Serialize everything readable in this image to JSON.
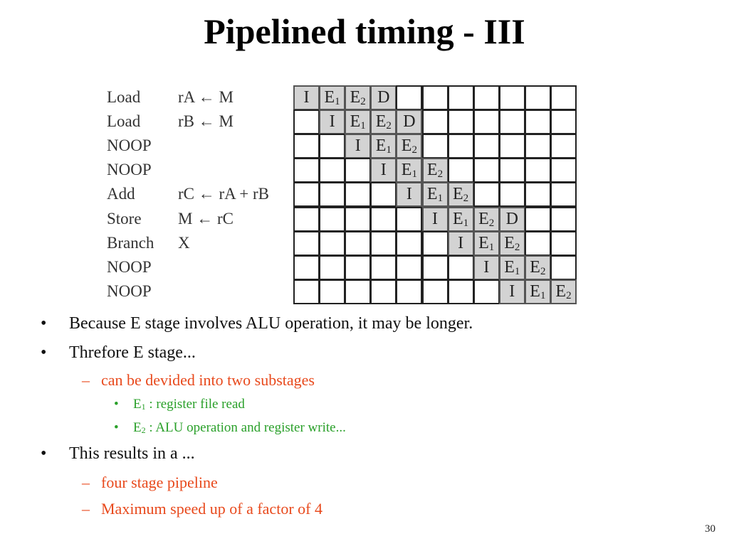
{
  "slide": {
    "title": "Pipelined timing - III",
    "page_number": "30"
  },
  "diagram": {
    "instructions": [
      {
        "op": "Load",
        "arg": "rA ← M"
      },
      {
        "op": "Load",
        "arg": "rB ← M"
      },
      {
        "op": "NOOP",
        "arg": ""
      },
      {
        "op": "NOOP",
        "arg": ""
      },
      {
        "op": "Add",
        "arg": "rC ← rA + rB"
      },
      {
        "op": "Store",
        "arg": "M ← rC"
      },
      {
        "op": "Branch",
        "arg": "X"
      },
      {
        "op": "NOOP",
        "arg": ""
      },
      {
        "op": "NOOP",
        "arg": ""
      }
    ],
    "columns": 11,
    "rows": [
      {
        "start": 0,
        "stages": [
          "I",
          "E1",
          "E2",
          "D"
        ]
      },
      {
        "start": 1,
        "stages": [
          "I",
          "E1",
          "E2",
          "D"
        ]
      },
      {
        "start": 2,
        "stages": [
          "I",
          "E1",
          "E2"
        ]
      },
      {
        "start": 3,
        "stages": [
          "I",
          "E1",
          "E2"
        ]
      },
      {
        "start": 4,
        "stages": [
          "I",
          "E1",
          "E2"
        ]
      },
      {
        "start": 5,
        "stages": [
          "I",
          "E1",
          "E2",
          "D"
        ]
      },
      {
        "start": 6,
        "stages": [
          "I",
          "E1",
          "E2"
        ]
      },
      {
        "start": 7,
        "stages": [
          "I",
          "E1",
          "E2"
        ]
      },
      {
        "start": 8,
        "stages": [
          "I",
          "E1",
          "E2"
        ]
      }
    ],
    "colors": {
      "filled": "#d3d3d3",
      "empty": "#ffffff",
      "border": "#222222"
    }
  },
  "bullets": [
    {
      "level": 1,
      "marker": "•",
      "text": "Because E stage involves ALU operation, it may be longer."
    },
    {
      "level": 1,
      "marker": "•",
      "text": "Threfore E stage..."
    },
    {
      "level": 2,
      "marker": "–",
      "text": "can be devided into two substages"
    },
    {
      "level": 3,
      "marker": "•",
      "base": "E",
      "sub": "1",
      "text": " : register file read"
    },
    {
      "level": 3,
      "marker": "•",
      "base": "E",
      "sub": "2",
      "text": " : ALU operation and register write..."
    },
    {
      "level": 1,
      "marker": "•",
      "text": "This results in a ..."
    },
    {
      "level": 2,
      "marker": "–",
      "text": "four stage pipeline"
    },
    {
      "level": 2,
      "marker": "–",
      "text": "Maximum speed up of a factor of 4"
    }
  ],
  "colors": {
    "level1": "#111111",
    "level2": "#e8491c",
    "level3": "#2aa02a"
  }
}
